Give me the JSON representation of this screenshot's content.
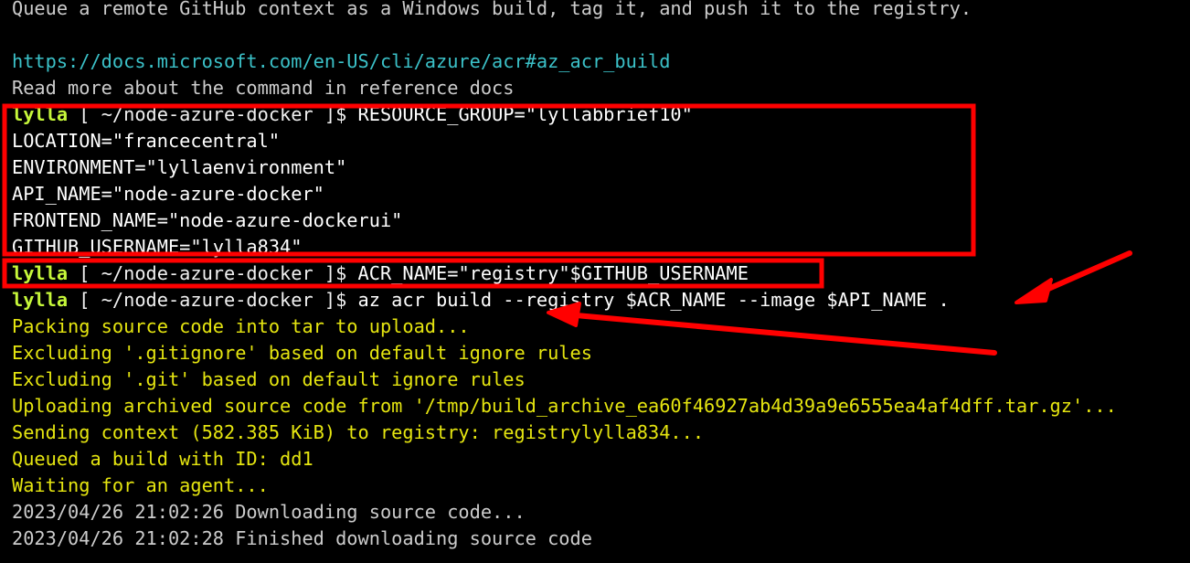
{
  "terminal": {
    "description_line": "Queue a remote GitHub context as a Windows build, tag it, and push it to the registry.",
    "doc_url": "https://docs.microsoft.com/en-US/cli/azure/acr#az_acr_build",
    "read_more": "Read more about the command in reference docs",
    "prompt": {
      "user": "lylla",
      "path": " [ ~/node-azure-docker ]$ "
    },
    "commands": {
      "resource_group": "RESOURCE_GROUP=\"lyllabbrief10\"",
      "location": "LOCATION=\"francecentral\"",
      "environment": "ENVIRONMENT=\"lyllaenvironment\"",
      "api_name": "API_NAME=\"node-azure-docker\"",
      "frontend_name": "FRONTEND_NAME=\"node-azure-dockerui\"",
      "github_username": "GITHUB_USERNAME=\"lylla834\"",
      "acr_name": "ACR_NAME=\"registry\"$GITHUB_USERNAME",
      "acr_build": "az acr build --registry $ACR_NAME --image $API_NAME ."
    },
    "output": [
      "Packing source code into tar to upload...",
      "Excluding '.gitignore' based on default ignore rules",
      "Excluding '.git' based on default ignore rules",
      "Uploading archived source code from '/tmp/build_archive_ea60f46927ab4d39a9e6555ea4af4dff.tar.gz'...",
      "Sending context (582.385 KiB) to registry: registrylylla834...",
      "Queued a build with ID: dd1",
      "Waiting for an agent...",
      "2023/04/26 21:02:26 Downloading source code...",
      "2023/04/26 21:02:28 Finished downloading source code"
    ]
  },
  "colors": {
    "background": "#000000",
    "text": "#cccccc",
    "link": "#3bc1c8",
    "output_yellow": "#e5e510",
    "prompt_user": "#c6f73a",
    "annotation_red": "#ff0000"
  }
}
